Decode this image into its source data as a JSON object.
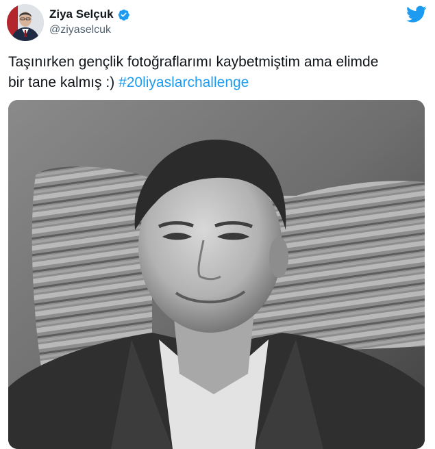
{
  "tweet": {
    "author": {
      "display_name": "Ziya Selçuk",
      "handle": "@ziyaselcuk",
      "verified_icon": "verified-badge-icon"
    },
    "brand": {
      "icon": "twitter-bird-icon",
      "color": "#1d9bf0"
    },
    "text": {
      "line_1": "Taşınırken gençlik fotoğraflarımı kaybetmiştim ama elimde",
      "line_2_prefix": "bir tane kalmış :) ",
      "hashtag": "#20liyaslarchallenge"
    },
    "media": {
      "kind": "black-and-white photo",
      "subject": "young man smiling, leaning on a striped chair"
    }
  }
}
